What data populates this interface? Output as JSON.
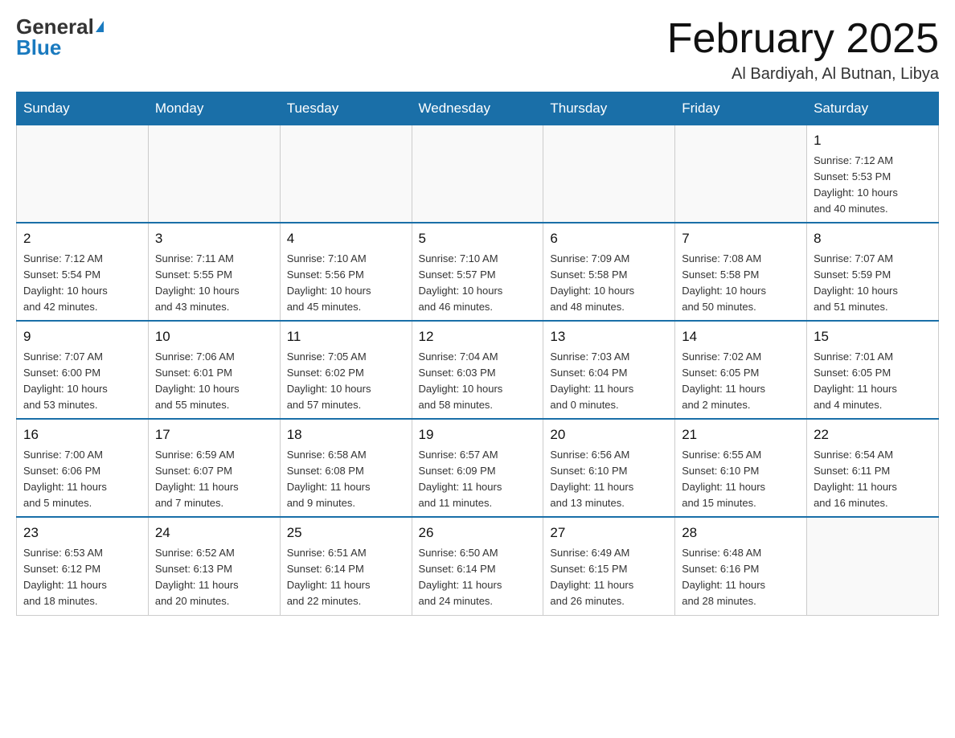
{
  "header": {
    "logo_general": "General",
    "logo_blue": "Blue",
    "month_title": "February 2025",
    "location": "Al Bardiyah, Al Butnan, Libya"
  },
  "days_of_week": [
    "Sunday",
    "Monday",
    "Tuesday",
    "Wednesday",
    "Thursday",
    "Friday",
    "Saturday"
  ],
  "weeks": [
    {
      "days": [
        {
          "date": "",
          "info": ""
        },
        {
          "date": "",
          "info": ""
        },
        {
          "date": "",
          "info": ""
        },
        {
          "date": "",
          "info": ""
        },
        {
          "date": "",
          "info": ""
        },
        {
          "date": "",
          "info": ""
        },
        {
          "date": "1",
          "info": "Sunrise: 7:12 AM\nSunset: 5:53 PM\nDaylight: 10 hours\nand 40 minutes."
        }
      ]
    },
    {
      "days": [
        {
          "date": "2",
          "info": "Sunrise: 7:12 AM\nSunset: 5:54 PM\nDaylight: 10 hours\nand 42 minutes."
        },
        {
          "date": "3",
          "info": "Sunrise: 7:11 AM\nSunset: 5:55 PM\nDaylight: 10 hours\nand 43 minutes."
        },
        {
          "date": "4",
          "info": "Sunrise: 7:10 AM\nSunset: 5:56 PM\nDaylight: 10 hours\nand 45 minutes."
        },
        {
          "date": "5",
          "info": "Sunrise: 7:10 AM\nSunset: 5:57 PM\nDaylight: 10 hours\nand 46 minutes."
        },
        {
          "date": "6",
          "info": "Sunrise: 7:09 AM\nSunset: 5:58 PM\nDaylight: 10 hours\nand 48 minutes."
        },
        {
          "date": "7",
          "info": "Sunrise: 7:08 AM\nSunset: 5:58 PM\nDaylight: 10 hours\nand 50 minutes."
        },
        {
          "date": "8",
          "info": "Sunrise: 7:07 AM\nSunset: 5:59 PM\nDaylight: 10 hours\nand 51 minutes."
        }
      ]
    },
    {
      "days": [
        {
          "date": "9",
          "info": "Sunrise: 7:07 AM\nSunset: 6:00 PM\nDaylight: 10 hours\nand 53 minutes."
        },
        {
          "date": "10",
          "info": "Sunrise: 7:06 AM\nSunset: 6:01 PM\nDaylight: 10 hours\nand 55 minutes."
        },
        {
          "date": "11",
          "info": "Sunrise: 7:05 AM\nSunset: 6:02 PM\nDaylight: 10 hours\nand 57 minutes."
        },
        {
          "date": "12",
          "info": "Sunrise: 7:04 AM\nSunset: 6:03 PM\nDaylight: 10 hours\nand 58 minutes."
        },
        {
          "date": "13",
          "info": "Sunrise: 7:03 AM\nSunset: 6:04 PM\nDaylight: 11 hours\nand 0 minutes."
        },
        {
          "date": "14",
          "info": "Sunrise: 7:02 AM\nSunset: 6:05 PM\nDaylight: 11 hours\nand 2 minutes."
        },
        {
          "date": "15",
          "info": "Sunrise: 7:01 AM\nSunset: 6:05 PM\nDaylight: 11 hours\nand 4 minutes."
        }
      ]
    },
    {
      "days": [
        {
          "date": "16",
          "info": "Sunrise: 7:00 AM\nSunset: 6:06 PM\nDaylight: 11 hours\nand 5 minutes."
        },
        {
          "date": "17",
          "info": "Sunrise: 6:59 AM\nSunset: 6:07 PM\nDaylight: 11 hours\nand 7 minutes."
        },
        {
          "date": "18",
          "info": "Sunrise: 6:58 AM\nSunset: 6:08 PM\nDaylight: 11 hours\nand 9 minutes."
        },
        {
          "date": "19",
          "info": "Sunrise: 6:57 AM\nSunset: 6:09 PM\nDaylight: 11 hours\nand 11 minutes."
        },
        {
          "date": "20",
          "info": "Sunrise: 6:56 AM\nSunset: 6:10 PM\nDaylight: 11 hours\nand 13 minutes."
        },
        {
          "date": "21",
          "info": "Sunrise: 6:55 AM\nSunset: 6:10 PM\nDaylight: 11 hours\nand 15 minutes."
        },
        {
          "date": "22",
          "info": "Sunrise: 6:54 AM\nSunset: 6:11 PM\nDaylight: 11 hours\nand 16 minutes."
        }
      ]
    },
    {
      "days": [
        {
          "date": "23",
          "info": "Sunrise: 6:53 AM\nSunset: 6:12 PM\nDaylight: 11 hours\nand 18 minutes."
        },
        {
          "date": "24",
          "info": "Sunrise: 6:52 AM\nSunset: 6:13 PM\nDaylight: 11 hours\nand 20 minutes."
        },
        {
          "date": "25",
          "info": "Sunrise: 6:51 AM\nSunset: 6:14 PM\nDaylight: 11 hours\nand 22 minutes."
        },
        {
          "date": "26",
          "info": "Sunrise: 6:50 AM\nSunset: 6:14 PM\nDaylight: 11 hours\nand 24 minutes."
        },
        {
          "date": "27",
          "info": "Sunrise: 6:49 AM\nSunset: 6:15 PM\nDaylight: 11 hours\nand 26 minutes."
        },
        {
          "date": "28",
          "info": "Sunrise: 6:48 AM\nSunset: 6:16 PM\nDaylight: 11 hours\nand 28 minutes."
        },
        {
          "date": "",
          "info": ""
        }
      ]
    }
  ]
}
